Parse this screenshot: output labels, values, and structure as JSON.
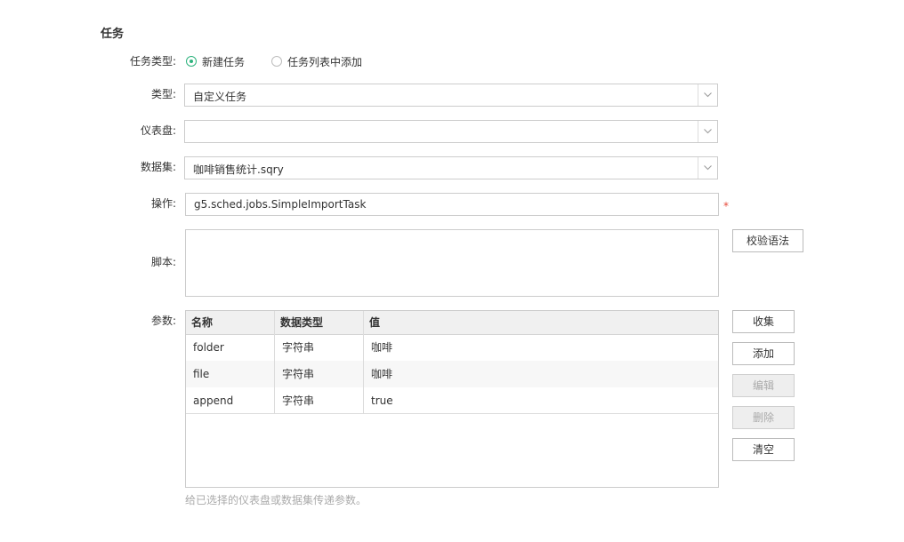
{
  "section": {
    "title": "任务"
  },
  "task_type": {
    "label": "任务类型:",
    "options": [
      {
        "label": "新建任务",
        "checked": true
      },
      {
        "label": "任务列表中添加",
        "checked": false
      }
    ]
  },
  "type": {
    "label": "类型:",
    "value": "自定义任务"
  },
  "dashboard": {
    "label": "仪表盘:",
    "value": ""
  },
  "dataset": {
    "label": "数据集:",
    "value": "咖啡销售统计.sqry"
  },
  "operation": {
    "label": "操作:",
    "value": "g5.sched.jobs.SimpleImportTask",
    "required_mark": "*"
  },
  "script": {
    "label": "脚本:",
    "value": "",
    "validate_button": "校验语法"
  },
  "params": {
    "label": "参数:",
    "columns": [
      "名称",
      "数据类型",
      "值"
    ],
    "rows": [
      {
        "name": "folder",
        "type": "字符串",
        "value": "咖啡"
      },
      {
        "name": "file",
        "type": "字符串",
        "value": "咖啡"
      },
      {
        "name": "append",
        "type": "字符串",
        "value": "true"
      }
    ],
    "buttons": {
      "collect": "收集",
      "add": "添加",
      "edit": "编辑",
      "delete": "删除",
      "clear": "清空"
    },
    "hint": "给已选择的仪表盘或数据集传递参数。"
  },
  "colors": {
    "accent": "#2db37d",
    "required": "#e74c3c",
    "border": "#cccccc"
  },
  "icons": {
    "combo_arrow": "chevron-down-icon"
  }
}
